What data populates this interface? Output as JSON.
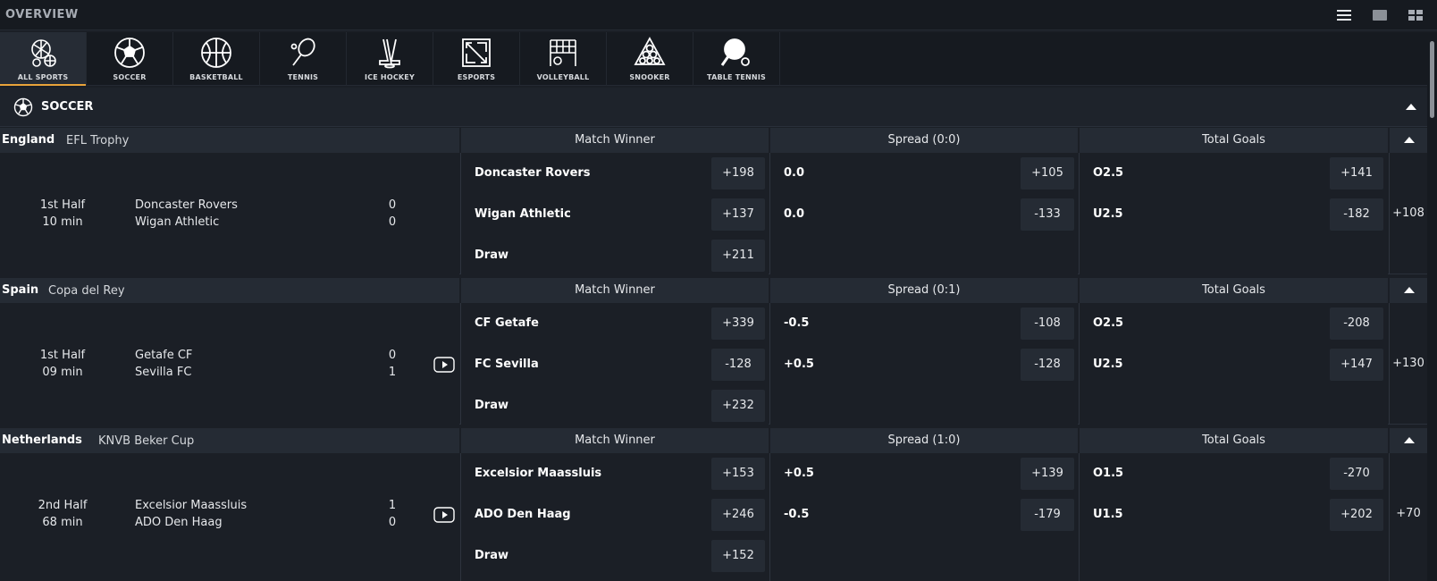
{
  "header": {
    "title": "OVERVIEW"
  },
  "view_modes": [
    "list-view-icon",
    "single-view-icon",
    "grid-view-icon"
  ],
  "sports_tabs": [
    {
      "label": "ALL SPORTS",
      "icon": "all-sports-icon",
      "active": true
    },
    {
      "label": "SOCCER",
      "icon": "soccer-ball-icon"
    },
    {
      "label": "BASKETBALL",
      "icon": "basketball-icon"
    },
    {
      "label": "TENNIS",
      "icon": "tennis-racket-icon"
    },
    {
      "label": "ICE HOCKEY",
      "icon": "hockey-sticks-icon"
    },
    {
      "label": "ESPORTS",
      "icon": "esports-icon"
    },
    {
      "label": "VOLLEYBALL",
      "icon": "volleyball-net-icon"
    },
    {
      "label": "SNOOKER",
      "icon": "snooker-balls-icon"
    },
    {
      "label": "TABLE TENNIS",
      "icon": "table-tennis-icon"
    }
  ],
  "section": {
    "name": "SOCCER"
  },
  "leagues": [
    {
      "country": "England",
      "competition": "EFL Trophy",
      "markets": [
        "Match Winner",
        "Spread (0:0)",
        "Total Goals"
      ],
      "period": "1st Half",
      "clock": "10 min",
      "home": "Doncaster Rovers",
      "away": "Wigan Athletic",
      "home_score": "0",
      "away_score": "0",
      "winner": [
        {
          "name": "Doncaster Rovers",
          "odd": "+198"
        },
        {
          "name": "Wigan Athletic",
          "odd": "+137"
        },
        {
          "name": "Draw",
          "odd": "+211"
        }
      ],
      "spread": [
        {
          "line": "0.0",
          "odd": "+105"
        },
        {
          "line": "0.0",
          "odd": "-133"
        }
      ],
      "totals": [
        {
          "line": "O2.5",
          "odd": "+141"
        },
        {
          "line": "U2.5",
          "odd": "-182"
        }
      ],
      "more": "+108"
    },
    {
      "country": "Spain",
      "competition": "Copa del Rey",
      "markets": [
        "Match Winner",
        "Spread (0:1)",
        "Total Goals"
      ],
      "period": "1st Half",
      "clock": "09 min",
      "home": "Getafe CF",
      "away": "Sevilla FC",
      "home_score": "0",
      "away_score": "1",
      "winner": [
        {
          "name": "CF Getafe",
          "odd": "+339"
        },
        {
          "name": "FC Sevilla",
          "odd": "-128"
        },
        {
          "name": "Draw",
          "odd": "+232"
        }
      ],
      "spread": [
        {
          "line": "-0.5",
          "odd": "-108"
        },
        {
          "line": "+0.5",
          "odd": "-128"
        }
      ],
      "totals": [
        {
          "line": "O2.5",
          "odd": "-208"
        },
        {
          "line": "U2.5",
          "odd": "+147"
        }
      ],
      "more": "+130"
    },
    {
      "country": "Netherlands",
      "competition": "KNVB Beker Cup",
      "markets": [
        "Match Winner",
        "Spread (1:0)",
        "Total Goals"
      ],
      "period": "2nd Half",
      "clock": "68 min",
      "home": "Excelsior Maassluis",
      "away": "ADO Den Haag",
      "home_score": "1",
      "away_score": "0",
      "winner": [
        {
          "name": "Excelsior Maassluis",
          "odd": "+153"
        },
        {
          "name": "ADO Den Haag",
          "odd": "+246"
        },
        {
          "name": "Draw",
          "odd": "+152"
        }
      ],
      "spread": [
        {
          "line": "+0.5",
          "odd": "+139"
        },
        {
          "line": "-0.5",
          "odd": "-179"
        }
      ],
      "totals": [
        {
          "line": "O1.5",
          "odd": "-270"
        },
        {
          "line": "U1.5",
          "odd": "+202"
        }
      ],
      "more": "+70"
    }
  ]
}
